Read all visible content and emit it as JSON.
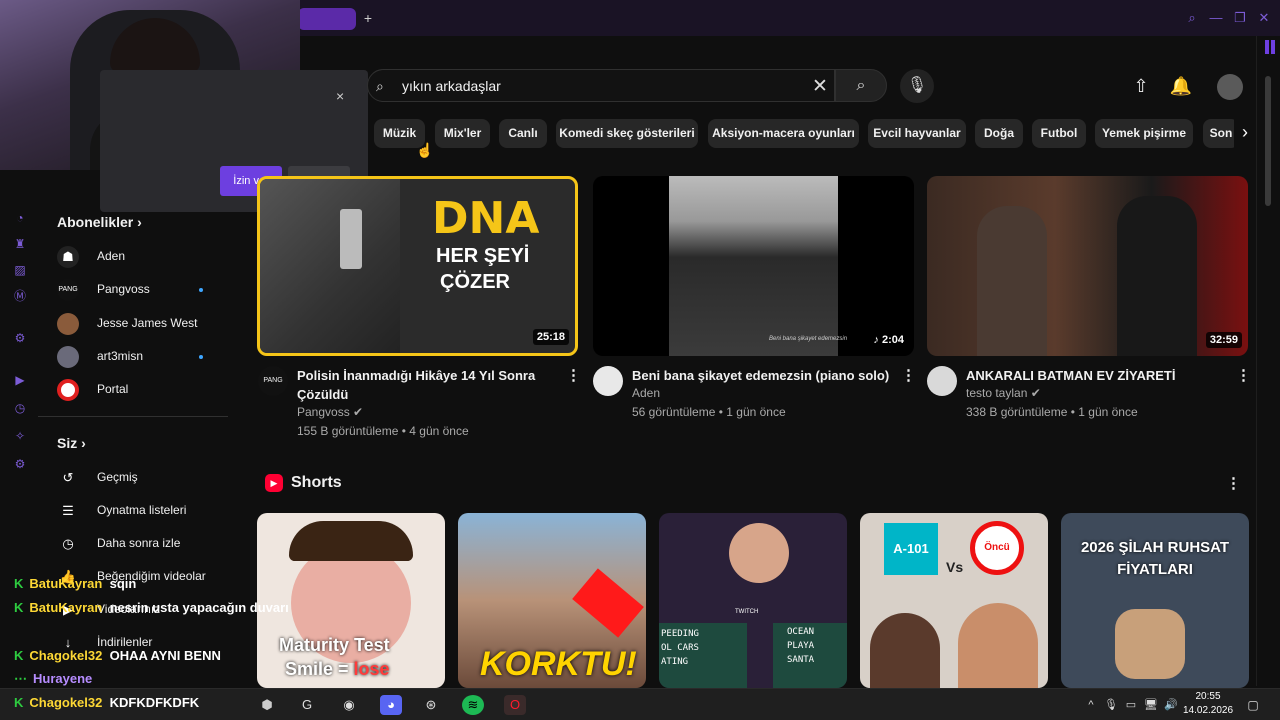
{
  "browser": {
    "new_tab": "+",
    "search_icon": "search-icon",
    "minimize": "—",
    "restore": "❐",
    "close": "✕"
  },
  "permission_popup": {
    "allow_label": "İzin ver",
    "block_label": "Engelle",
    "close": "×"
  },
  "search": {
    "value": "yıkın arkadaşlar",
    "clear": "✕"
  },
  "chips": [
    "Müzik",
    "Mix'ler",
    "Canlı",
    "Komedi skeç gösterileri",
    "Aksiyon-macera oyunları",
    "Evcil hayvanlar",
    "Doğa",
    "Futbol",
    "Yemek pişirme",
    "Son"
  ],
  "sidebar": {
    "subscriptions_title": "Abonelikler",
    "subscriptions": [
      {
        "label": "Aden",
        "new": false
      },
      {
        "label": "Pangvoss",
        "new": true
      },
      {
        "label": "Jesse James West",
        "new": false
      },
      {
        "label": "art3misn",
        "new": true
      },
      {
        "label": "Portal",
        "new": false
      }
    ],
    "you_title": "Siz",
    "you_items": [
      {
        "label": "Geçmiş",
        "icon": "history-icon"
      },
      {
        "label": "Oynatma listeleri",
        "icon": "playlists-icon"
      },
      {
        "label": "Daha sonra izle",
        "icon": "watch-later-icon"
      },
      {
        "label": "Beğendiğim videolar",
        "icon": "like-icon"
      },
      {
        "label": "Videolarınız",
        "icon": "your-videos-icon"
      },
      {
        "label": "İndirilenler",
        "icon": "download-icon"
      }
    ]
  },
  "videos": [
    {
      "thumb_text1": "DNA",
      "thumb_text2": "HER ŞEYİ",
      "thumb_text3": "ÇÖZER",
      "duration": "25:18",
      "title": "Polisin İnanmadığı Hikâye 14 Yıl Sonra Çözüldü",
      "channel": "Pangvoss",
      "verified": true,
      "meta": "155 B görüntüleme • 4 gün önce"
    },
    {
      "thumb_caption": "Beni bana şikayet edemezsin",
      "duration": "♪ 2:04",
      "title": "Beni bana şikayet edemezsin (piano solo)",
      "channel": "Aden",
      "verified": false,
      "meta": "56 görüntüleme • 1 gün önce"
    },
    {
      "duration": "32:59",
      "title": "ANKARALI BATMAN EV ZİYARETİ",
      "channel": "testo taylan",
      "verified": true,
      "meta": "338 B görüntüleme • 1 gün önce"
    }
  ],
  "shorts": {
    "title": "Shorts",
    "items": [
      {
        "text1": "Maturity Test",
        "text2": "Smile = ",
        "text3": "lose"
      },
      {
        "text1": "KORKTU!"
      },
      {
        "text1": "PEEDING",
        "text2": "OL CARS",
        "text3": "ATING",
        "text4": "OCEAN",
        "text5": "PLAYA",
        "text6": "SANTA",
        "text7": "TWITCH"
      },
      {
        "text1": "A-101",
        "text2": "Vs",
        "text3": "Öncü"
      },
      {
        "text1": "2026 ŞİLAH RUHSAT",
        "text2": "FİYATLARI"
      }
    ]
  },
  "chat": [
    {
      "user": "BatuKayran",
      "msg": "sqın"
    },
    {
      "user": "BatuKayran",
      "msg": "nesrin usta yapacağın duvarı"
    },
    {
      "user": "Chagokel32",
      "msg": "OHAA AYNI BENN"
    },
    {
      "user": "Hurayene",
      "msg": ""
    },
    {
      "user": "Chagokel32",
      "msg": "KDFKDFKDFK"
    }
  ],
  "taskbar": {
    "time": "20:55",
    "date": "14.02.2026"
  }
}
